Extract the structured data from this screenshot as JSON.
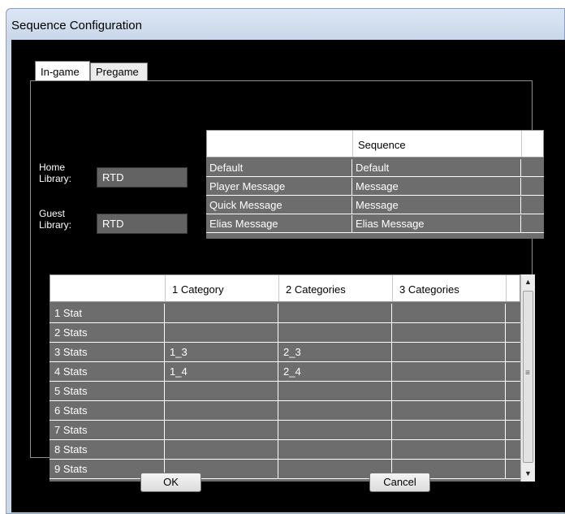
{
  "window": {
    "title": "Sequence Configuration"
  },
  "tabs": [
    {
      "label": "In-game",
      "active": true
    },
    {
      "label": "Pregame",
      "active": false
    }
  ],
  "home_library": {
    "label_line1": "Home",
    "label_line2": "Library:",
    "value": "RTD"
  },
  "guest_library": {
    "label_line1": "Guest",
    "label_line2": "Library:",
    "value": "RTD"
  },
  "sequence_grid": {
    "headers": [
      "",
      "Sequence"
    ],
    "rows": [
      [
        "Default",
        "Default"
      ],
      [
        "Player Message",
        "Message"
      ],
      [
        "Quick Message",
        "Message"
      ],
      [
        "Elias Message",
        "Elias Message"
      ]
    ]
  },
  "stats_grid": {
    "headers": [
      "",
      "1 Category",
      "2 Categories",
      "3 Categories"
    ],
    "rows": [
      [
        "1 Stat",
        "",
        "",
        ""
      ],
      [
        "2 Stats",
        "",
        "",
        ""
      ],
      [
        "3 Stats",
        "1_3",
        "2_3",
        ""
      ],
      [
        "4 Stats",
        "1_4",
        "2_4",
        ""
      ],
      [
        "5 Stats",
        "",
        "",
        ""
      ],
      [
        "6 Stats",
        "",
        "",
        ""
      ],
      [
        "7 Stats",
        "",
        "",
        ""
      ],
      [
        "8 Stats",
        "",
        "",
        ""
      ],
      [
        "9 Stats",
        "",
        "",
        ""
      ]
    ]
  },
  "scrollbar": {
    "up_glyph": "▲",
    "down_glyph": "▼",
    "grip_glyph": "≡"
  },
  "buttons": {
    "ok": "OK",
    "cancel": "Cancel"
  }
}
